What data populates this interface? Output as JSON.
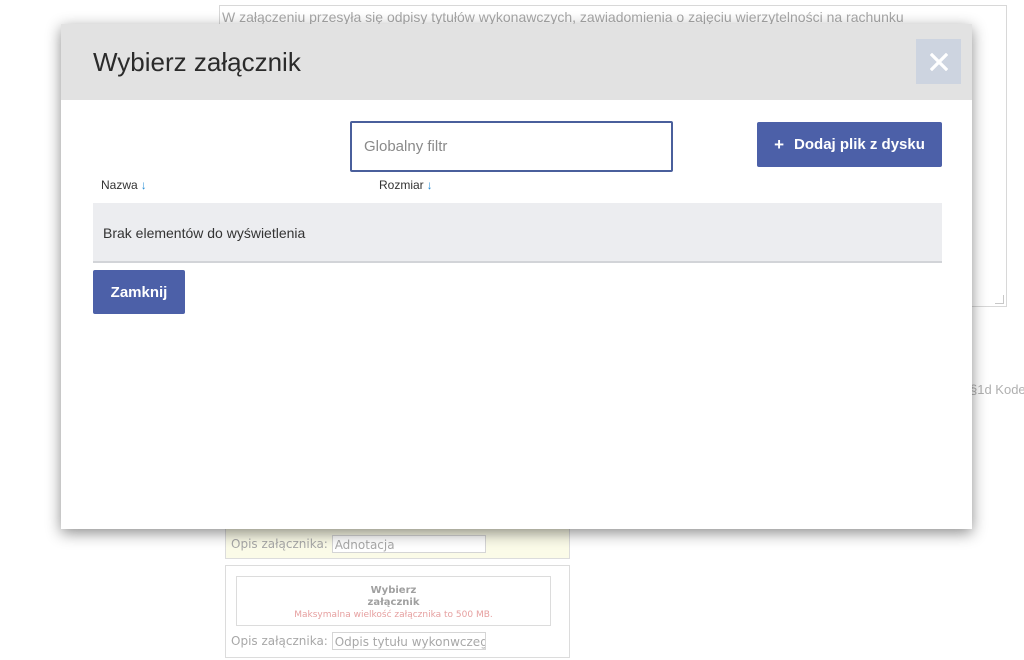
{
  "background": {
    "textarea_text": "W załączeniu przesyła się odpisy tytułów wykonawczych, zawiadomienia o zajęciu wierzytelności na rachunku",
    "side_text": "§1d Kode",
    "card_yellow": {
      "opis_label": "Opis załącznika:",
      "opis_value": "Adnotacja"
    },
    "card_white": {
      "pick_title": "Wybierz załącznik",
      "pick_subtitle": "Maksymalna wielkość załącznika to 500 MB.",
      "opis_label": "Opis załącznika:",
      "opis_value": "Odpis tytułu wykonwczego"
    }
  },
  "modal": {
    "title": "Wybierz załącznik",
    "close_icon": "close-icon",
    "filter_placeholder": "Globalny filtr",
    "add_button": {
      "icon": "plus-icon",
      "label": "Dodaj plik z dysku"
    },
    "columns": [
      {
        "label": "Nazwa",
        "sort_icon": "sort-down-arrow-icon"
      },
      {
        "label": "Rozmiar",
        "sort_icon": "sort-down-arrow-icon"
      }
    ],
    "empty_message": "Brak elementów do wyświetlenia",
    "close_button_label": "Zamknij"
  },
  "colors": {
    "primary_button": "#4c60a8",
    "header_bg": "#e2e2e2",
    "close_bg": "#cdd4e0",
    "sort_arrow": "#2a8fd6"
  }
}
